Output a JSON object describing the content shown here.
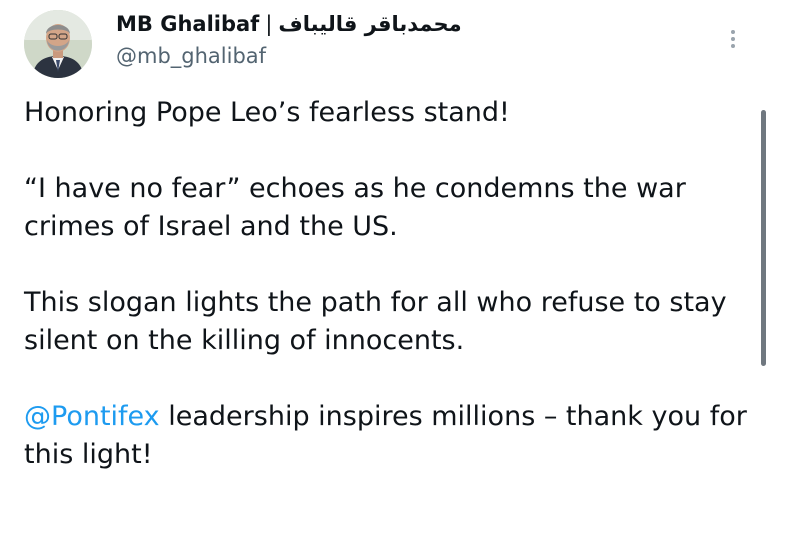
{
  "author": {
    "display_name": "MB Ghalibaf",
    "separator": "|",
    "display_name_arabic": "محمدباقر قالیباف",
    "handle": "@mb_ghalibaf",
    "avatar_icon": "person-portrait-icon"
  },
  "menu": {
    "icon": "more-vertical-icon"
  },
  "tweet": {
    "paragraphs": [
      "Honoring Pope Leo’s fearless stand!",
      "“I have no fear” echoes as he condemns the war crimes of Israel and the US.",
      "This slogan lights the path for all who refuse to stay silent on the killing of innocents."
    ],
    "mention": "@Pontifex",
    "final_text": " leadership inspires millions – thank you for this light!"
  },
  "colors": {
    "text": "#0f1419",
    "secondary": "#536471",
    "link": "#1d9bf0",
    "scrollbar": "#707880"
  }
}
